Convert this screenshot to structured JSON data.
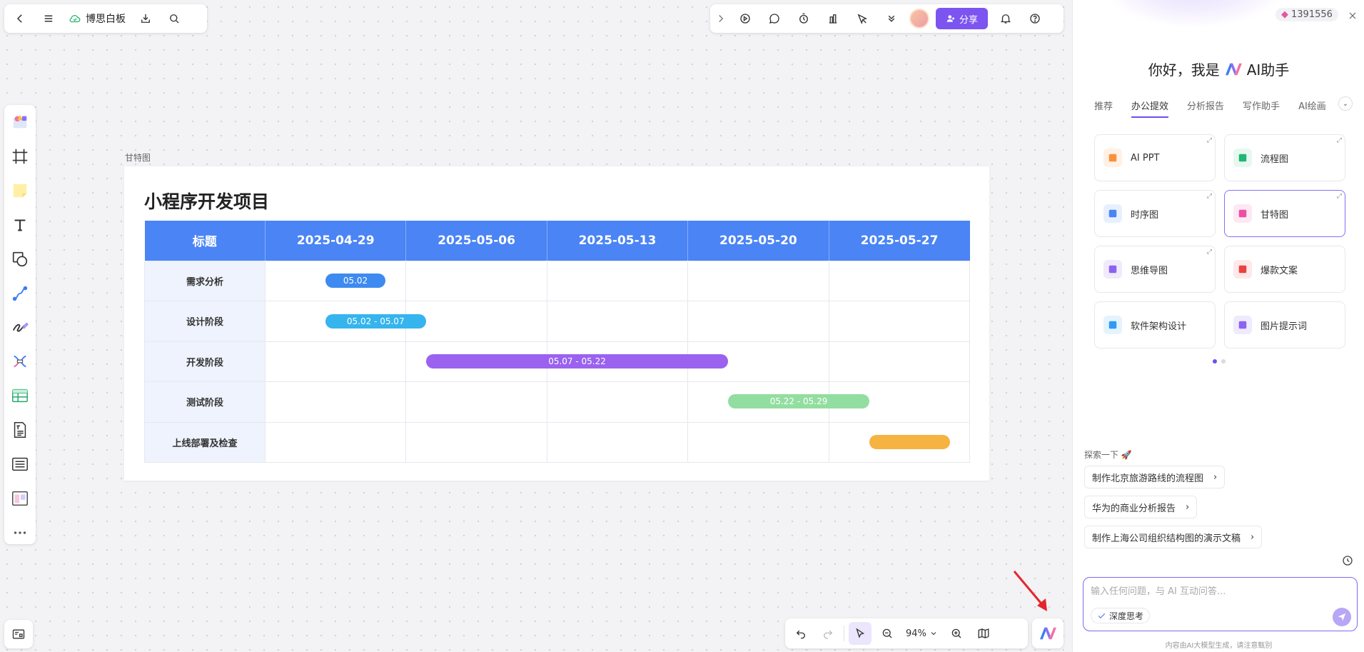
{
  "app": {
    "doc_title": "博思白板",
    "share_label": "分享",
    "zoom": "94%"
  },
  "colors": {
    "accent": "#7c54f0",
    "header_blue": "#4a84f5",
    "row_label_bg": "#eef3fd"
  },
  "frame": {
    "label": "甘特图",
    "title": "小程序开发项目"
  },
  "gantt": {
    "header_label": "标题",
    "dates": [
      "2025-04-29",
      "2025-05-06",
      "2025-05-13",
      "2025-05-20",
      "2025-05-27"
    ],
    "rows": [
      {
        "task": "需求分析",
        "bar_label": "05.02",
        "start": "2025-05-02",
        "end": "2025-05-02",
        "color": "#3d8af0"
      },
      {
        "task": "设计阶段",
        "bar_label": "05.02 - 05.07",
        "start": "2025-05-02",
        "end": "2025-05-07",
        "color": "#35b4ee"
      },
      {
        "task": "开发阶段",
        "bar_label": "05.07 - 05.22",
        "start": "2025-05-07",
        "end": "2025-05-22",
        "color": "#9a62ef"
      },
      {
        "task": "测试阶段",
        "bar_label": "05.22 - 05.29",
        "start": "2025-05-22",
        "end": "2025-05-29",
        "color": "#92dea0"
      },
      {
        "task": "上线部署及检查",
        "bar_label": "",
        "start": "2025-05-29",
        "end": "2025-06-02",
        "color": "#f6b342"
      }
    ]
  },
  "ai_panel": {
    "credits": "1391556",
    "greeting_prefix": "你好，我是",
    "greeting_suffix": "AI助手",
    "tabs": [
      "推荐",
      "办公提效",
      "分析报告",
      "写作助手",
      "AI绘画"
    ],
    "active_tab": "办公提效",
    "cards": [
      {
        "label": "AI PPT",
        "icon": "ppt-icon",
        "color": "#f7923b",
        "bg": "#fff1e6",
        "pinned": true
      },
      {
        "label": "流程图",
        "icon": "flowchart-icon",
        "color": "#22b573",
        "bg": "#e6f8ef",
        "pinned": true
      },
      {
        "label": "时序图",
        "icon": "sequence-icon",
        "color": "#4a84f5",
        "bg": "#e8f0fe",
        "pinned": true
      },
      {
        "label": "甘特图",
        "icon": "gantt-icon",
        "color": "#ec4fa3",
        "bg": "#fde8f3",
        "pinned": true
      },
      {
        "label": "思维导图",
        "icon": "mindmap-icon",
        "color": "#8c63f0",
        "bg": "#f0eafd",
        "pinned": true
      },
      {
        "label": "爆款文案",
        "icon": "copywriting-icon",
        "color": "#e9433f",
        "bg": "#fde9e9",
        "pinned": false
      },
      {
        "label": "软件架构设计",
        "icon": "architecture-icon",
        "color": "#2f9bf5",
        "bg": "#e5f3fe",
        "pinned": false
      },
      {
        "label": "图片提示词",
        "icon": "image-prompt-icon",
        "color": "#8c63f0",
        "bg": "#f0eafd",
        "pinned": false
      }
    ],
    "explore_title": "探索一下",
    "suggestions": [
      "制作北京旅游路线的流程图",
      "华为的商业分析报告",
      "制作上海公司组织结构图的演示文稿"
    ],
    "input_placeholder": "输入任何问题，与 AI 互动问答...",
    "deep_think": "深度思考",
    "disclaimer": "内容由AI大模型生成，请注意甄别"
  }
}
